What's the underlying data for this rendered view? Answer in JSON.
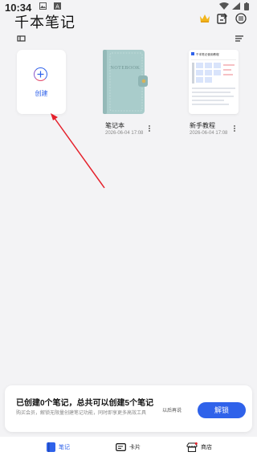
{
  "status": {
    "time": "10:34"
  },
  "app": {
    "title": "千本笔记"
  },
  "create": {
    "label": "创建"
  },
  "notebooks": [
    {
      "title": "笔记本",
      "date": "2026-06-04 17:08",
      "cover_text": "NOTEBOOK",
      "cover_color": "#a9cccb"
    },
    {
      "title": "新手教程",
      "date": "2026-06-04 17:08",
      "cover_heading": "千本笔记使用教程"
    }
  ],
  "panel": {
    "title": "已创建0个笔记，总共可以创建5个笔记",
    "desc": "购买会员，解锁无限量创建笔记功能，同时即享更多高效工具",
    "later": "以后再说",
    "unlock": "解锁"
  },
  "tabs": [
    {
      "label": "笔记",
      "active": true
    },
    {
      "label": "卡片",
      "active": false
    },
    {
      "label": "商店",
      "active": false
    }
  ],
  "colors": {
    "accent": "#2f62ea",
    "arrow": "#e5202b",
    "crown": "#f2b51b"
  }
}
